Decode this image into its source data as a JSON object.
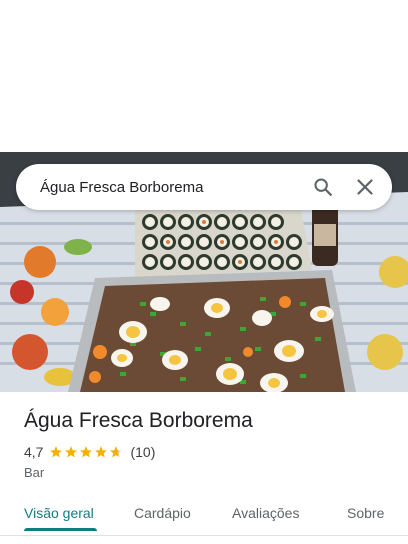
{
  "search": {
    "query": "Água Fresca Borborema",
    "search_icon": "search-icon",
    "close_icon": "close-icon"
  },
  "place": {
    "name": "Água Fresca Borborema",
    "rating": "4,7",
    "rating_value": 4.7,
    "review_count": "(10)",
    "category": "Bar"
  },
  "tabs": [
    {
      "label": "Visão geral",
      "active": true
    },
    {
      "label": "Cardápio",
      "active": false
    },
    {
      "label": "Avaliações",
      "active": false
    },
    {
      "label": "Sobre",
      "active": false
    }
  ],
  "colors": {
    "accent": "#147b83",
    "star": "#f6b100"
  }
}
